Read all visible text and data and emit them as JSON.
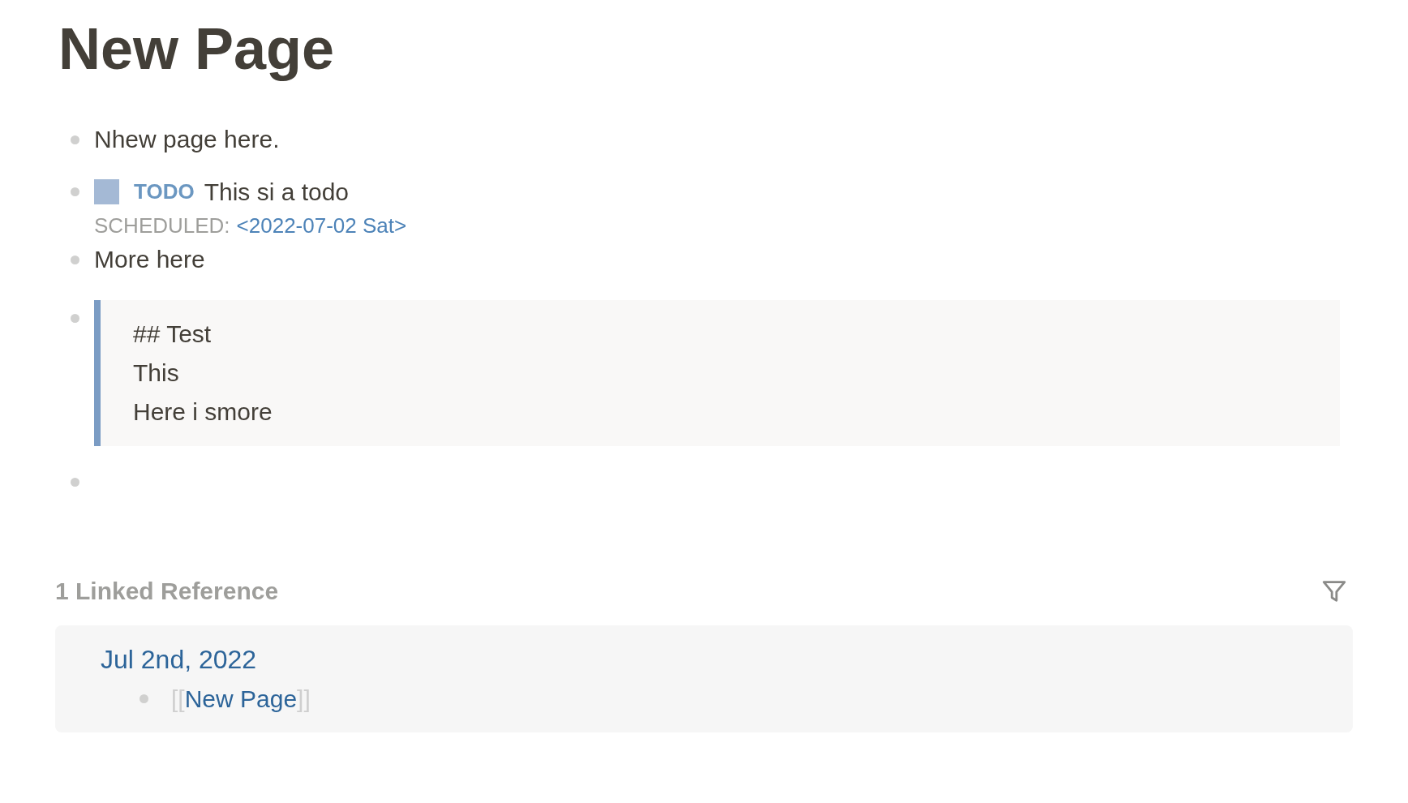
{
  "page": {
    "title": "New Page"
  },
  "blocks": [
    {
      "kind": "text",
      "text": "Nhew page here."
    },
    {
      "kind": "todo",
      "marker": "TODO",
      "checked": false,
      "text": "This si a todo",
      "scheduled_label": "SCHEDULED:",
      "scheduled_date": "<2022-07-02 Sat>"
    },
    {
      "kind": "text",
      "text": "More here"
    },
    {
      "kind": "quote",
      "lines": [
        "## Test",
        "This",
        "Here i smore"
      ]
    },
    {
      "kind": "empty"
    }
  ],
  "linked_references": {
    "heading": "1 Linked Reference",
    "groups": [
      {
        "page": "Jul 2nd, 2022",
        "items": [
          {
            "open": "[[",
            "link": "New Page",
            "close": "]]"
          }
        ]
      }
    ]
  }
}
